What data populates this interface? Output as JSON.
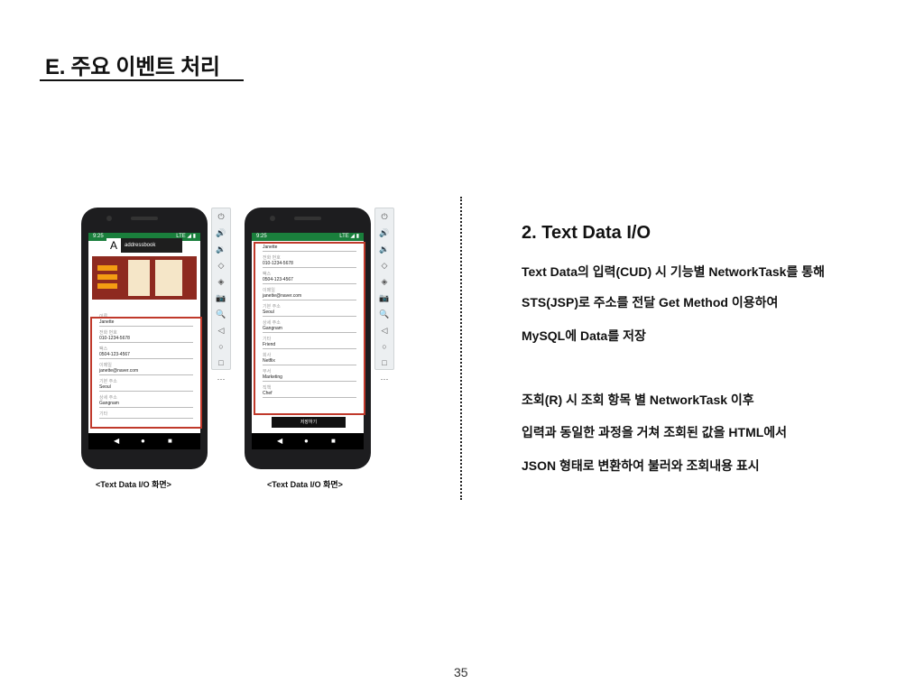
{
  "title": "E. 주요 이벤트 처리",
  "page_number": "35",
  "heading": "2.   Text Data I/O",
  "body_lines": [
    "Text Data의 입력(CUD) 시 기능별 NetworkTask를 통해",
    "STS(JSP)로 주소를 전달 Get Method 이용하여",
    "MySQL에 Data를 저장",
    "조회(R) 시 조회 항목 별 NetworkTask 이후",
    "입력과 동일한 과정을 거쳐 조회된 값을 HTML에서",
    "JSON 형태로 변환하여 불러와 조회내용 표시"
  ],
  "captions": [
    "<Text Data I/O 화면>",
    "<Text Data I/O 화면>"
  ],
  "phone1": {
    "time": "9:25",
    "status_right": "LTE ◢ ▮",
    "logo_text": "addressbook",
    "logo_mark": "A",
    "fields": [
      {
        "label": "이름",
        "value": "Janette"
      },
      {
        "label": "전화 번호",
        "value": "010-1234-5678"
      },
      {
        "label": "팩스",
        "value": "0504-123-4567"
      },
      {
        "label": "이메일",
        "value": "janette@naver.com"
      },
      {
        "label": "기본 주소",
        "value": "Seoul"
      },
      {
        "label": "상세 주소",
        "value": "Gangnam"
      },
      {
        "label": "기타",
        "value": ""
      }
    ]
  },
  "phone2": {
    "time": "9:25",
    "status_right": "LTE ◢ ▮",
    "fields": [
      {
        "label": "",
        "value": "Janette"
      },
      {
        "label": "전화 번호",
        "value": "010-1234-5678"
      },
      {
        "label": "팩스",
        "value": "0504-123-4567"
      },
      {
        "label": "이메일",
        "value": "janette@naver.com"
      },
      {
        "label": "기본 주소",
        "value": "Seoul"
      },
      {
        "label": "상세 주소",
        "value": "Gangnam"
      },
      {
        "label": "기타",
        "value": "Friend"
      },
      {
        "label": "회사",
        "value": "Netflix"
      },
      {
        "label": "부서",
        "value": "Marketing"
      },
      {
        "label": "직책",
        "value": "Chef"
      }
    ],
    "save_label": "저장하기"
  },
  "nav_icons": {
    "back": "◀",
    "home": "●",
    "recent": "■"
  },
  "emulator_toolbar": [
    "⏻",
    "🔊",
    "🔉",
    "◇",
    "◈",
    "📷",
    "🔍",
    "◁",
    "○",
    "□",
    "⋯"
  ],
  "colors": {
    "status_bar": "#1a7f3c",
    "highlight": "#c0392b"
  }
}
